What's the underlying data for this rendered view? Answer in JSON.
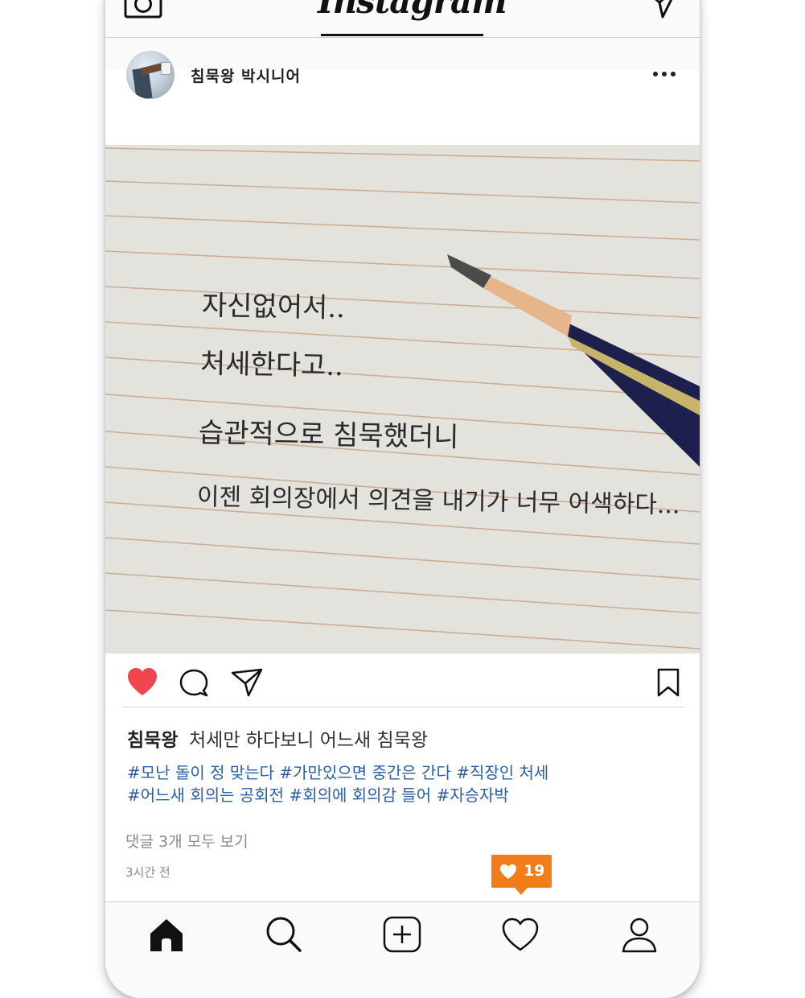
{
  "app": {
    "title": "Instagram"
  },
  "post": {
    "username": "침묵왕 박시니어",
    "image_text": {
      "line1": "자신없어서..",
      "line2": "처세한다고..",
      "line3": "습관적으로 침묵했더니",
      "line4": "이젠 회의장에서 의견을 내기가 너무 어색하다..."
    },
    "caption": {
      "user": "침묵왕",
      "text": "처세만 하다보니 어느새 침묵왕",
      "hashtags_line1": "#모난 돌이 정 맞는다 #가만있으면 중간은 간다 #직장인 처세",
      "hashtags_line2": "#어느새 회의는 공회전 #회의에 회의감 들어 #자승자박"
    },
    "comments_link": "댓글 3개 모두 보기",
    "time": "3시간 전",
    "likes_badge": "19"
  },
  "icons": {
    "top_left": "camera-icon",
    "top_right": "send-icon",
    "more": "more-icon",
    "like": "heart-icon",
    "comment": "comment-icon",
    "share": "share-icon",
    "bookmark": "bookmark-icon",
    "nav": [
      "home-icon",
      "search-icon",
      "add-icon",
      "activity-heart-icon",
      "profile-icon"
    ]
  },
  "colors": {
    "like_red": "#f0454f",
    "hashtag_blue": "#2a5fa6",
    "badge_orange": "#f07d1a"
  }
}
